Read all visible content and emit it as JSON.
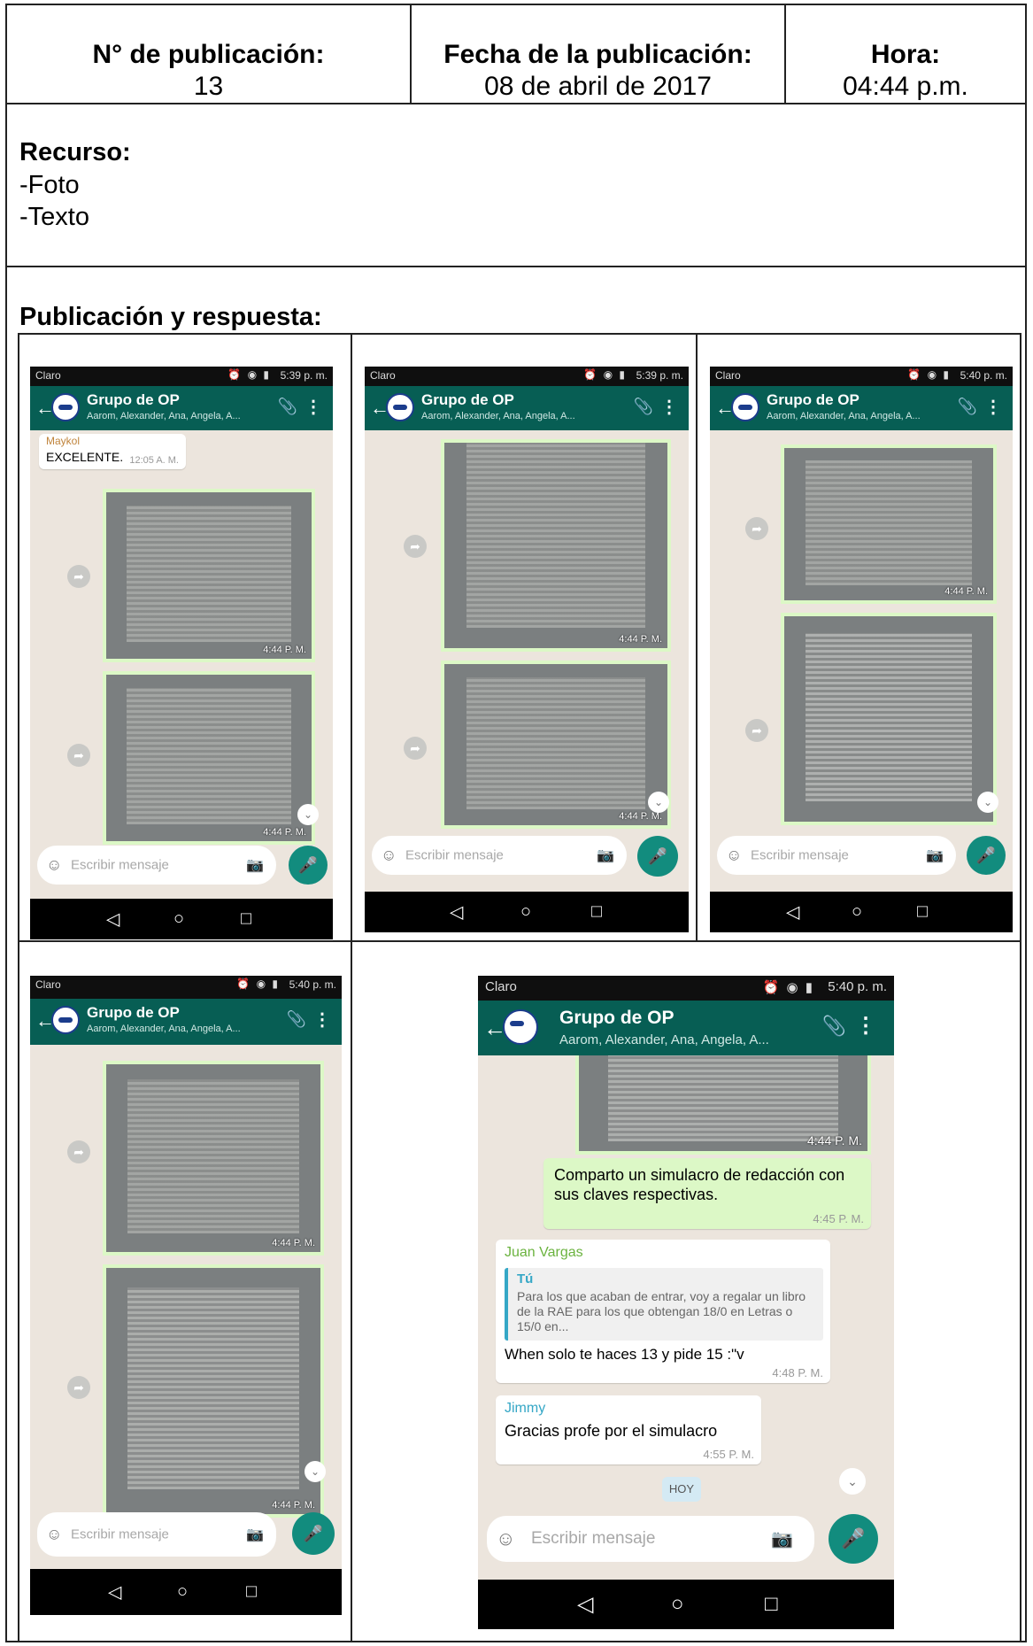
{
  "header": {
    "pub_label": "N°  de publicación:",
    "pub_value": "13",
    "date_label": "Fecha de la publicación:",
    "date_value": "08 de abril de 2017",
    "time_label": "Hora:",
    "time_value": "04:44 p.m."
  },
  "resource": {
    "title": "Recurso:",
    "items": [
      "-Foto",
      "-Texto"
    ]
  },
  "section_title": "Publicación y respuesta:",
  "chat": {
    "carrier": "Claro",
    "group_name": "Grupo de OP",
    "members": "Aarom, Alexander, Ana, Angela, A...",
    "placeholder": "Escribir mensaje",
    "times": [
      "5:39 p. m.",
      "5:39 p. m.",
      "5:40 p. m.",
      "5:40 p. m.",
      "5:40 p. m."
    ],
    "photo_time": "4:44 P. M.",
    "s1_sender": "Maykol",
    "s1_text": "EXCELENTE.",
    "s1_time": "12:05 A. M.",
    "caption_text": "Comparto un simulacro de redacción con sus claves respectivas.",
    "caption_time": "4:45 P. M.",
    "reply_sender": "Juan Vargas",
    "quote_author": "Tú",
    "quote_text": "Para los que acaban de entrar, voy a regalar un libro de la RAE para los que obtengan 18/0 en Letras o 15/0 en...",
    "reply_text": "When solo te haces 13 y pide 15 :\"v",
    "reply_time": "4:48 P. M.",
    "thanks_sender": "Jimmy",
    "thanks_text": "Gracias profe por el simulacro",
    "thanks_time": "4:55 P. M.",
    "day_badge": "HOY"
  },
  "colors": {
    "header_green": "#075e54",
    "outgoing_bubble": "#dcf8c6",
    "mic_button": "#128c7e",
    "sender_maykol": "#c0843c",
    "sender_juan": "#6bb33f",
    "sender_jimmy": "#35a7c6"
  },
  "icons": [
    "back-arrow-icon",
    "paperclip-icon",
    "more-vert-icon",
    "smiley-icon",
    "camera-icon",
    "mic-icon",
    "forward-icon",
    "scroll-down-icon",
    "nav-back-icon",
    "nav-home-icon",
    "nav-recents-icon"
  ]
}
